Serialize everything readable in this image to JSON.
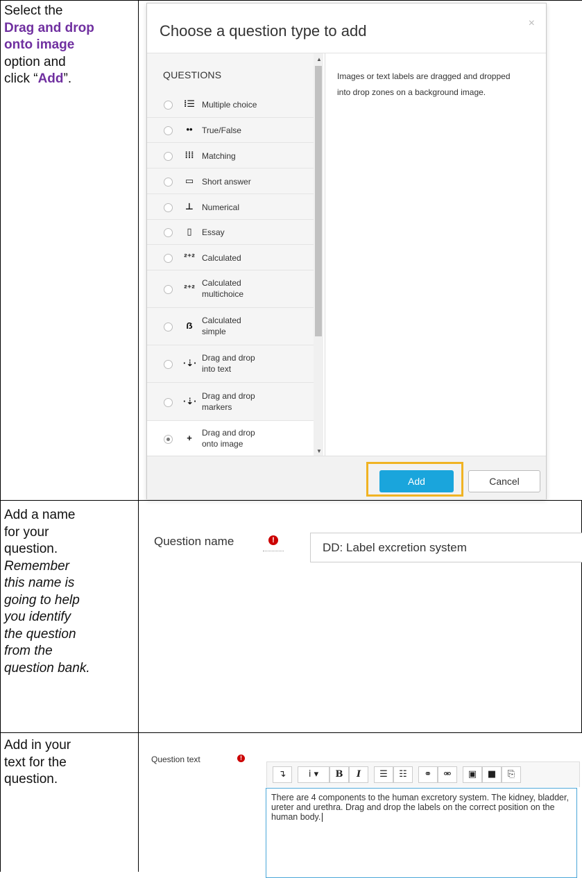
{
  "row1": {
    "instruction": {
      "line1": "Select the",
      "bold1": "Drag and drop",
      "bold2": "onto image",
      "line3": "option and",
      "pre": "click “",
      "bold3": "Add",
      "post": "”."
    },
    "dialog": {
      "title": "Choose a question type to add",
      "close": "×",
      "list_heading": "QUESTIONS",
      "items": [
        {
          "icon": "⁞☰",
          "label1": "Multiple choice",
          "label2": "",
          "selected": false
        },
        {
          "icon": "••",
          "label1": "True/False",
          "label2": "",
          "selected": false
        },
        {
          "icon": "⁞⁞⁞",
          "label1": "Matching",
          "label2": "",
          "selected": false
        },
        {
          "icon": "▭",
          "label1": "Short answer",
          "label2": "",
          "selected": false
        },
        {
          "icon": "⊥",
          "label1": "Numerical",
          "label2": "",
          "selected": false
        },
        {
          "icon": "▯",
          "label1": "Essay",
          "label2": "",
          "selected": false
        },
        {
          "icon": "²⁺²",
          "label1": "Calculated",
          "label2": "",
          "selected": false
        },
        {
          "icon": "²⁺²",
          "label1": "Calculated",
          "label2": "multichoice",
          "selected": false
        },
        {
          "icon": "ẞ",
          "label1": "Calculated",
          "label2": "simple",
          "selected": false
        },
        {
          "icon": "·⇣·",
          "label1": "Drag and drop",
          "label2": "into text",
          "selected": false
        },
        {
          "icon": "·⇣·",
          "label1": "Drag and drop",
          "label2": "markers",
          "selected": false
        },
        {
          "icon": "+",
          "label1": "Drag and drop",
          "label2": "onto image",
          "selected": true
        }
      ],
      "description": "Images or text labels are dragged and dropped into drop zones on a background image.",
      "add_label": "Add",
      "cancel_label": "Cancel"
    }
  },
  "row2": {
    "instruction_plain": [
      "Add a name",
      "for your",
      "question."
    ],
    "instruction_italic": [
      "Remember",
      "this name is",
      "going to help",
      "you identify",
      "the question",
      "from the",
      "question bank."
    ],
    "field_label": "Question name",
    "field_value": "DD: Label excretion system",
    "error_icon": "!"
  },
  "row3": {
    "instruction": [
      "Add in your",
      "text for the",
      "question."
    ],
    "field_label": "Question text",
    "error_icon": "!",
    "toolbar": {
      "expand": "↴",
      "style": "i ▾",
      "bold": "B",
      "italic": "I",
      "ul": "☰",
      "ol": "☷",
      "link": "⚭",
      "unlink": "⚮",
      "image": "▣",
      "media": "■",
      "copy": "⎘"
    },
    "editor_text": "There are 4 components to the human excretory system. The kidney, bladder, ureter and urethra. Drag and drop the labels on the correct position on the human body."
  },
  "colors": {
    "accent_purple": "#7030a0",
    "add_button": "#1aa5dc",
    "highlight": "#f0b323",
    "error": "#cc0000"
  }
}
